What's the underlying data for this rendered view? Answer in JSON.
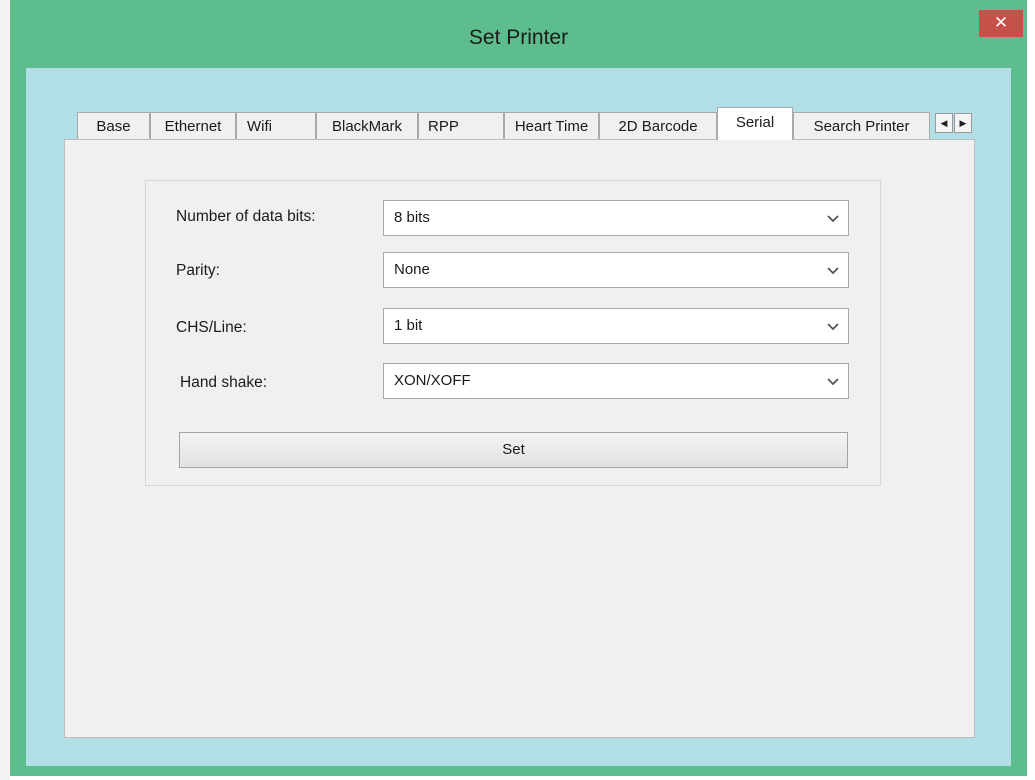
{
  "window": {
    "title": "Set Printer",
    "close_glyph": "✕",
    "accent_color": "#5dbd8c",
    "close_color": "#c7504b"
  },
  "tabs": [
    {
      "label": "Base",
      "active": false
    },
    {
      "label": "Ethernet",
      "active": false
    },
    {
      "label": "Wifi",
      "active": false
    },
    {
      "label": "BlackMark",
      "active": false
    },
    {
      "label": "RPP",
      "active": false
    },
    {
      "label": "Heart Time",
      "active": false
    },
    {
      "label": "2D Barcode",
      "active": false
    },
    {
      "label": "Serial",
      "active": true
    },
    {
      "label": "Search Printer",
      "active": false
    }
  ],
  "tab_scroll": {
    "left_glyph": "◀",
    "right_glyph": "▶"
  },
  "serial": {
    "data_bits": {
      "label": "Number of data bits:",
      "value": "8 bits"
    },
    "parity": {
      "label": "Parity:",
      "value": "None"
    },
    "chs_line": {
      "label": "CHS/Line:",
      "value": "1 bit"
    },
    "hand_shake": {
      "label": "Hand shake:",
      "value": "XON/XOFF"
    },
    "set_label": "Set"
  }
}
